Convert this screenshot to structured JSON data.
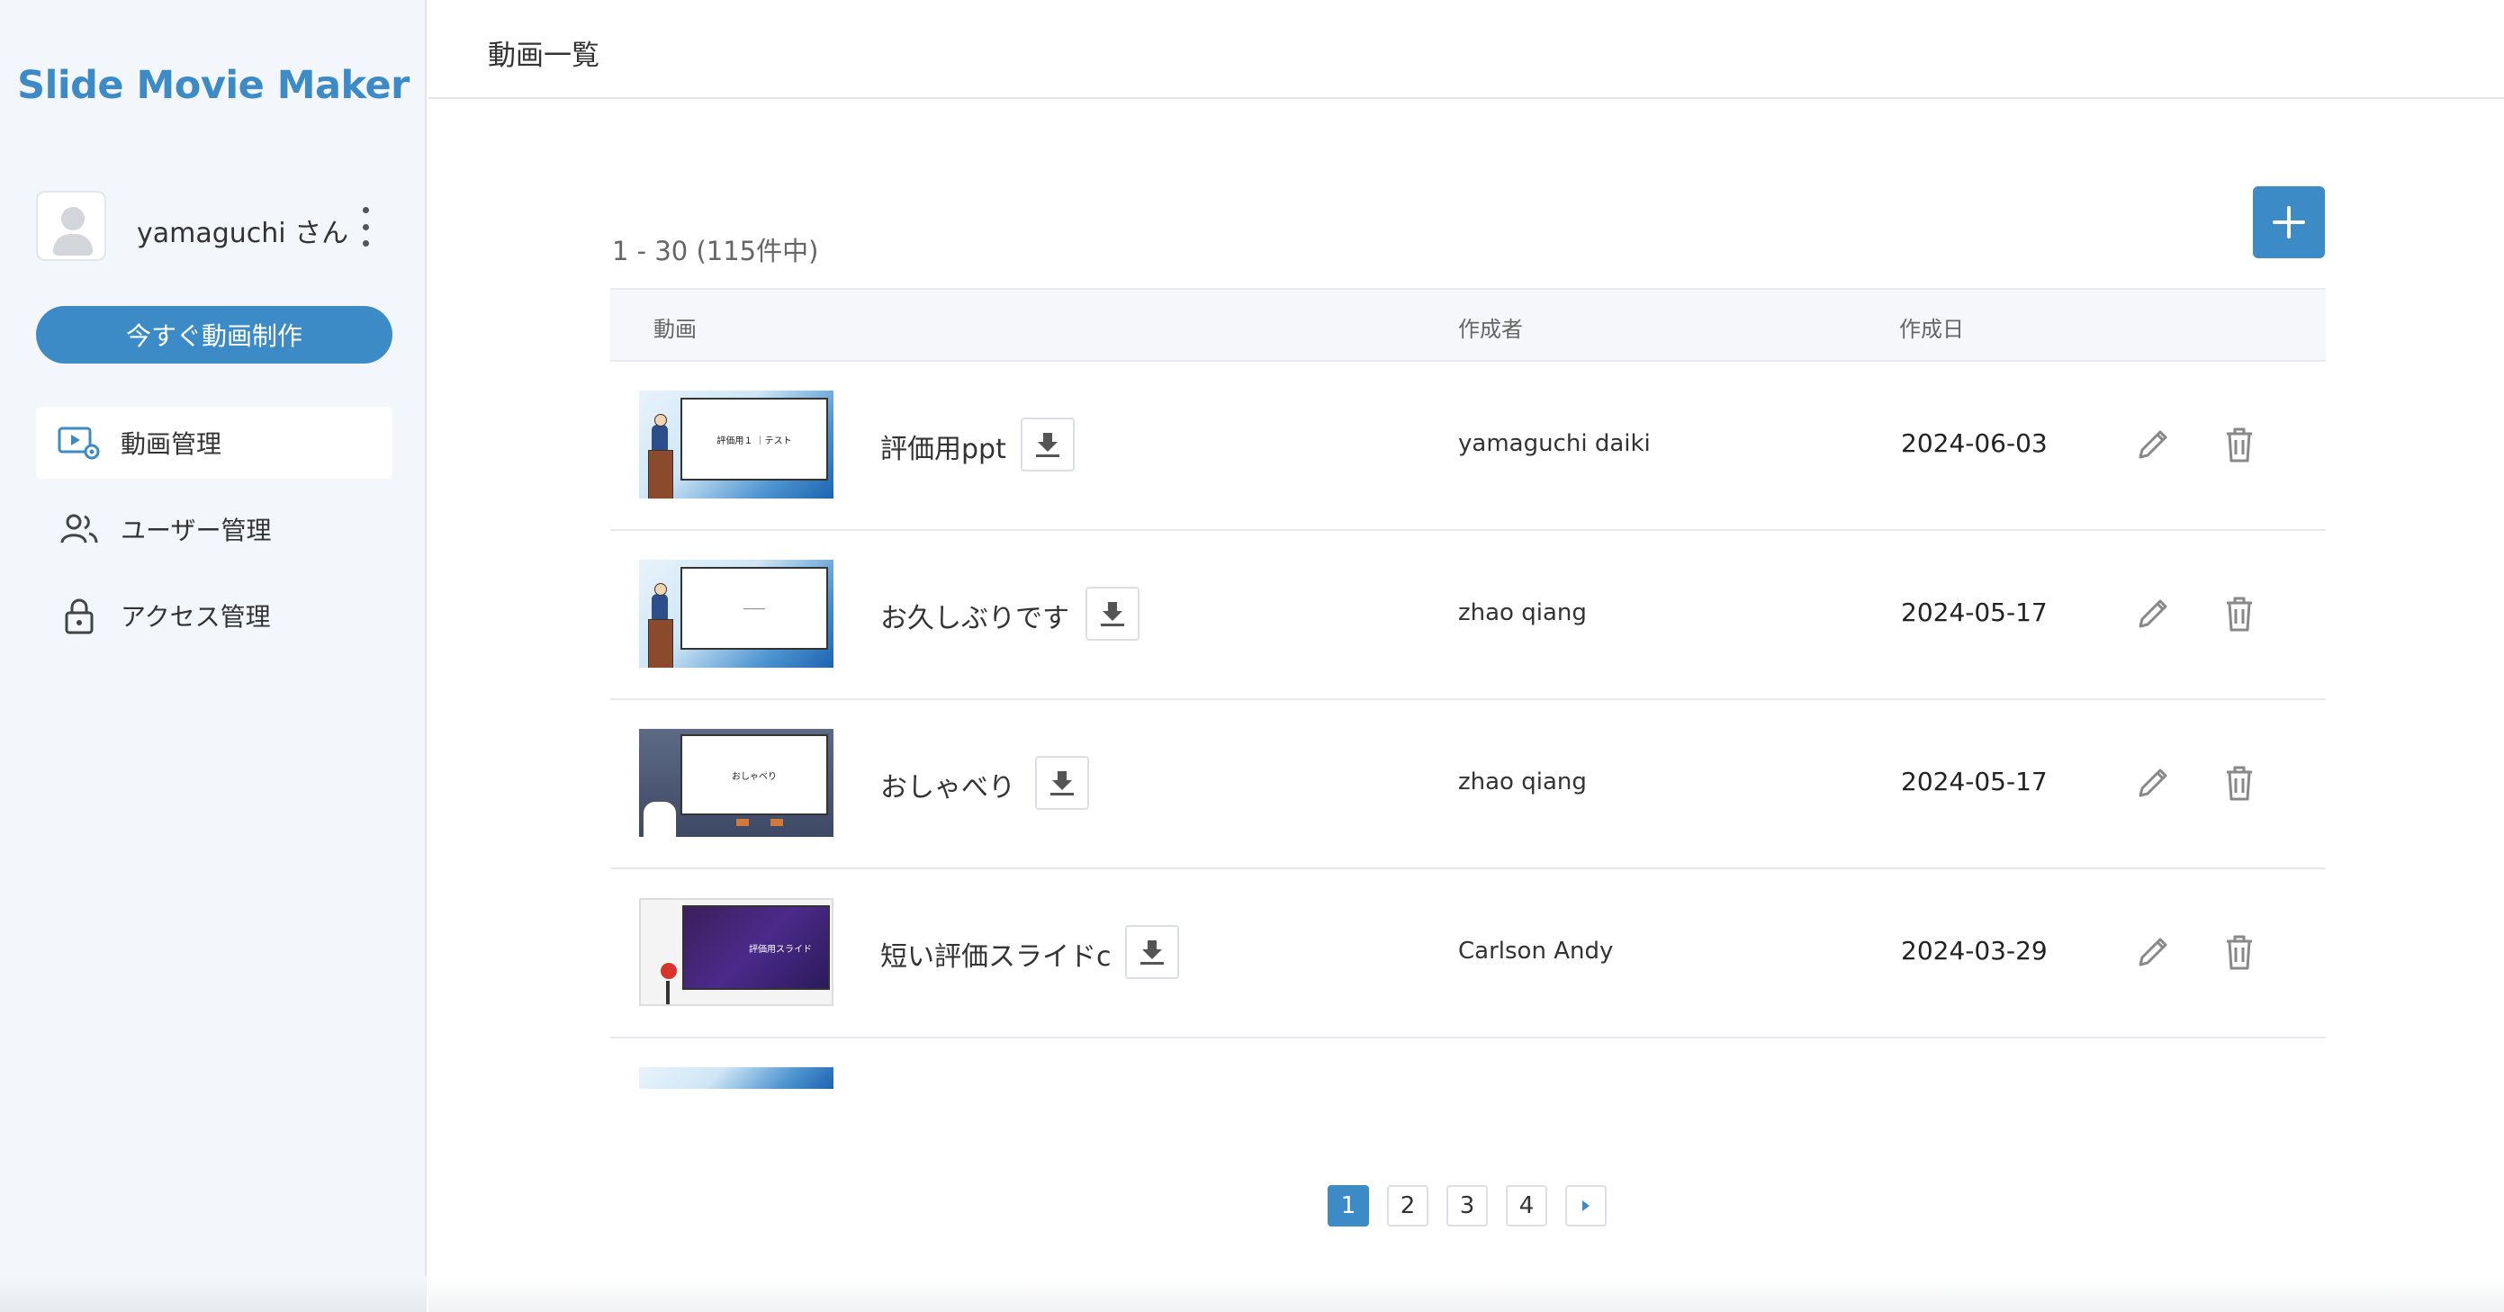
{
  "app": {
    "brand": "Slide Movie Maker"
  },
  "user": {
    "name": "yamaguchi さん"
  },
  "sidebar": {
    "create_button": "今すぐ動画制作",
    "items": [
      {
        "label": "動画管理",
        "icon": "video-settings-icon",
        "active": true
      },
      {
        "label": "ユーザー管理",
        "icon": "users-icon",
        "active": false
      },
      {
        "label": "アクセス管理",
        "icon": "lock-icon",
        "active": false
      }
    ]
  },
  "header": {
    "title": "動画一覧"
  },
  "list": {
    "count_text": "1 - 30 (115件中)",
    "columns": {
      "video": "動画",
      "author": "作成者",
      "date": "作成日"
    },
    "rows": [
      {
        "title": "評価用ppt",
        "author": "yamaguchi daiki",
        "date": "2024-06-03",
        "thumb_text": "評価用１ ｜テスト"
      },
      {
        "title": "お久しぶりです",
        "author": "zhao qiang",
        "date": "2024-05-17",
        "thumb_text": "―――"
      },
      {
        "title": "おしゃべり",
        "author": "zhao qiang",
        "date": "2024-05-17",
        "thumb_text": "おしゃべり"
      },
      {
        "title": "短い評価スライドc",
        "author": "Carlson Andy",
        "date": "2024-03-29",
        "thumb_text": "評価用スライド"
      }
    ]
  },
  "pagination": {
    "pages": [
      "1",
      "2",
      "3",
      "4"
    ],
    "current": "1"
  },
  "colors": {
    "accent": "#3d8bc6",
    "sidebar_bg": "#f3f6fb"
  }
}
